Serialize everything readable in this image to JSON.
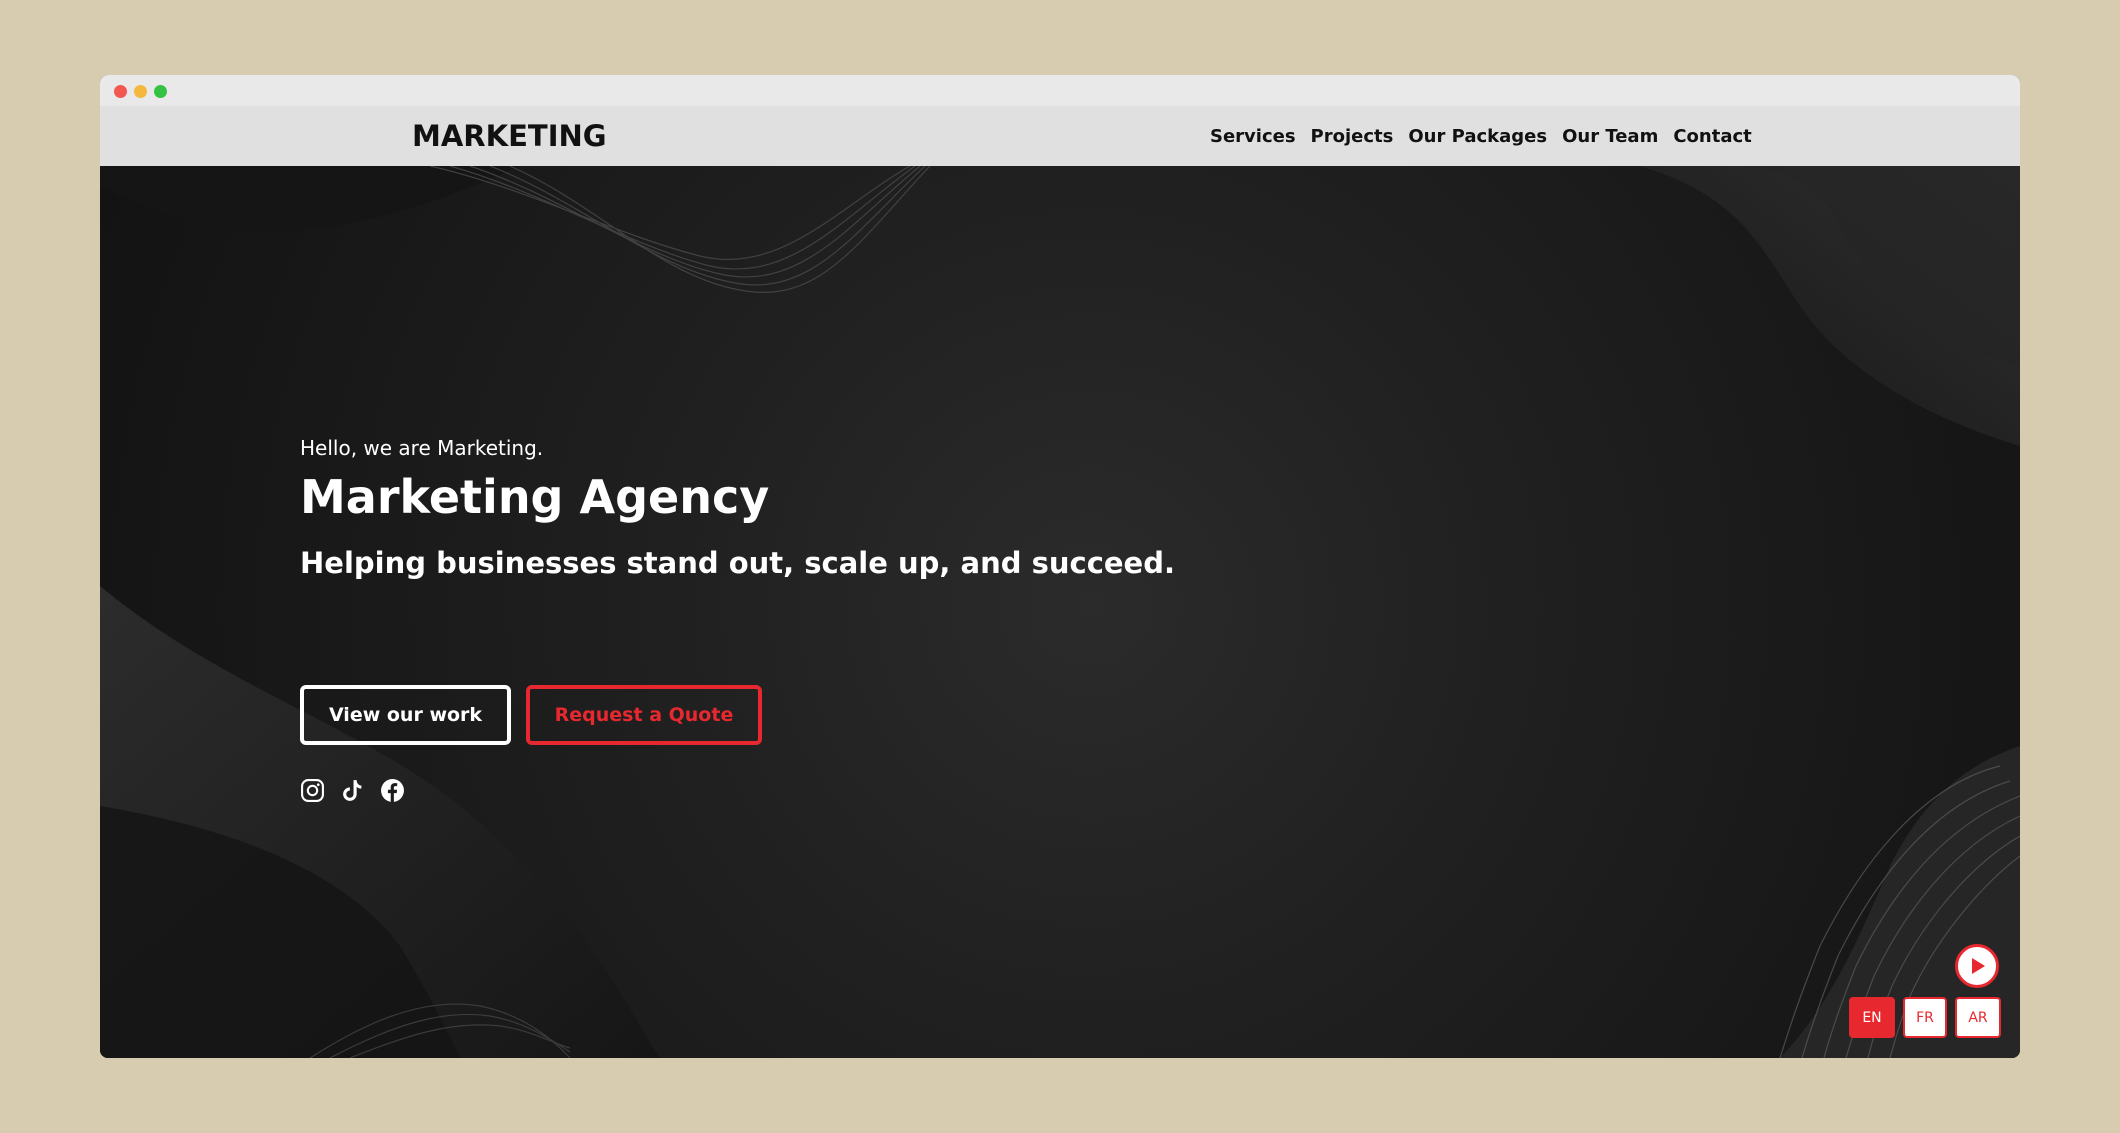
{
  "navbar": {
    "logo": "MARKETING",
    "links": [
      "Services",
      "Projects",
      "Our Packages",
      "Our Team",
      "Contact"
    ]
  },
  "hero": {
    "greeting": "Hello, we are Marketing.",
    "title": "Marketing Agency",
    "subtitle": "Helping businesses stand out, scale up, and succeed.",
    "primary_button": "View our work",
    "secondary_button": "Request a Quote",
    "social_icons": [
      "instagram-icon",
      "tiktok-icon",
      "facebook-icon"
    ]
  },
  "language_switcher": {
    "options": [
      "EN",
      "FR",
      "AR"
    ],
    "active": "EN"
  },
  "colors": {
    "accent": "#e8282f",
    "navbar_bg": "#e0e0e0",
    "hero_bg": "#1c1c1c",
    "page_bg": "#d7cbb0"
  }
}
